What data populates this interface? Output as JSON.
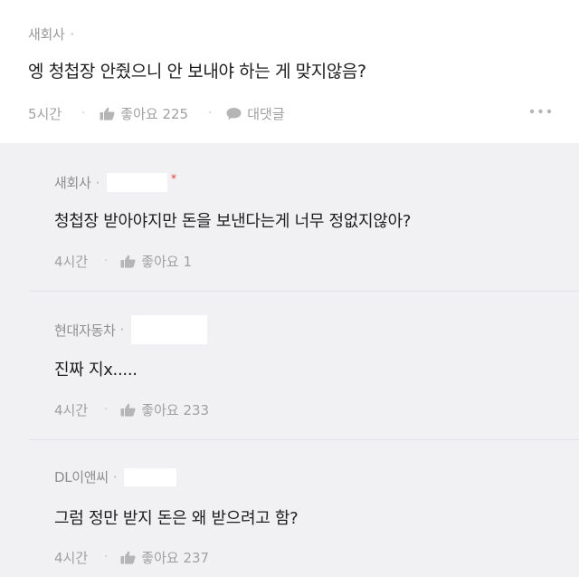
{
  "post": {
    "company": "새회사",
    "text": "엥 청첩장 안줬으니 안 보내야 하는 게 맞지않음?",
    "time": "5시간",
    "like_label": "좋아요 225",
    "comment_label": "대댓글"
  },
  "comments": [
    {
      "company": "새회사",
      "text": "청첩장 받아야지만 돈을 보낸다는게 너무 정없지않아?",
      "time": "4시간",
      "like_label": "좋아요 1",
      "author_mark": "*"
    },
    {
      "company": "현대자동차",
      "text": "진짜 지x.....",
      "time": "4시간",
      "like_label": "좋아요 233"
    },
    {
      "company": "DL이앤씨",
      "text": "그럼 정만 받지 돈은 왜 받으려고 함?",
      "time": "4시간",
      "like_label": "좋아요 237"
    }
  ],
  "icons": {
    "like": "thumbs-up-icon",
    "comment": "speech-bubble-icon",
    "more": "more-horizontal-icon"
  },
  "colors": {
    "comment_bg": "#f1f1f3",
    "meta_text": "#9a9a9a",
    "author_mark": "#e03a3a"
  }
}
